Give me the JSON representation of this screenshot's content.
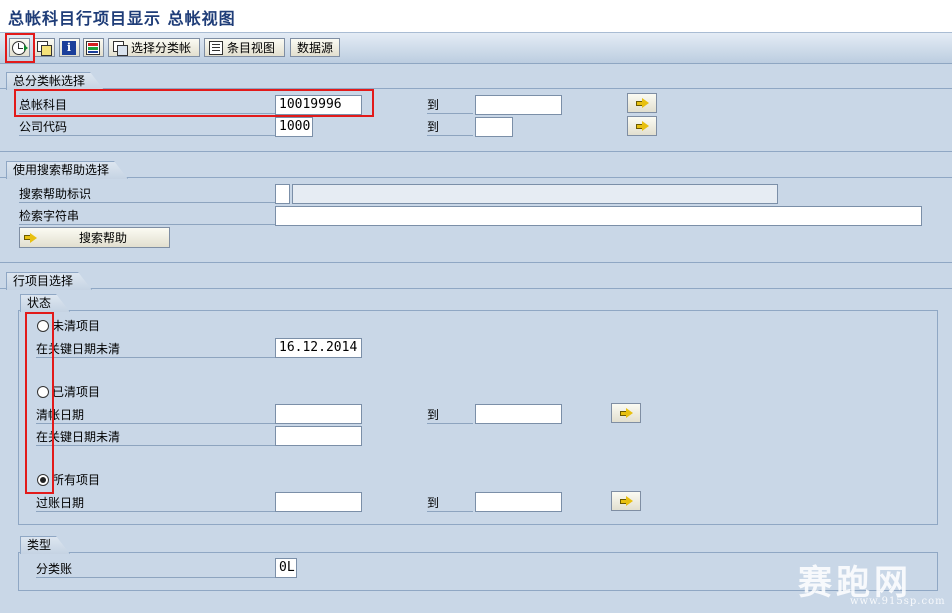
{
  "window": {
    "title": "总帐科目行项目显示 总帐视图"
  },
  "toolbar": {
    "select_subledger_label": "选择分类帐",
    "item_view_label": "条目视图",
    "data_source_label": "数据源"
  },
  "gl_selection": {
    "section_title": "总分类帐选择",
    "gl_account_label": "总帐科目",
    "gl_account_value": "10019996",
    "gl_account_to_label": "到",
    "gl_account_to_value": "",
    "company_code_label": "公司代码",
    "company_code_value": "1000",
    "company_code_to_label": "到",
    "company_code_to_value": ""
  },
  "search_help": {
    "section_title": "使用搜索帮助选择",
    "id_label": "搜索帮助标识",
    "id_value": "",
    "id_desc": "",
    "search_string_label": "检索字符串",
    "search_string_value": "",
    "button_label": "搜索帮助"
  },
  "line_items": {
    "section_title": "行项目选择",
    "status_title": "状态",
    "open_items_label": "未清项目",
    "open_items_selected": false,
    "open_key_date_label": "在关键日期未清",
    "open_key_date_value": "16.12.2014",
    "cleared_items_label": "已清项目",
    "cleared_items_selected": false,
    "clearing_date_label": "清帐日期",
    "clearing_date_value": "",
    "clearing_date_to_label": "到",
    "clearing_date_to_value": "",
    "cleared_open_key_date_label": "在关键日期未清",
    "cleared_open_key_date_value": "",
    "all_items_label": "所有项目",
    "all_items_selected": true,
    "posting_date_label": "过账日期",
    "posting_date_value": "",
    "posting_date_to_label": "到",
    "posting_date_to_value": "",
    "type_title": "类型",
    "ledger_label": "分类账",
    "ledger_value": "0L"
  },
  "watermark": {
    "brand": "赛跑网",
    "url": "www.915sp.com"
  }
}
